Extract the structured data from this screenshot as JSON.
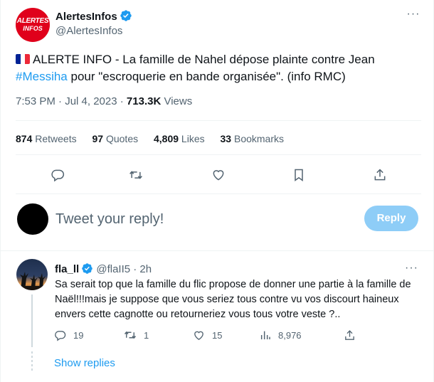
{
  "tweet": {
    "author": {
      "name": "AlertesInfos",
      "handle": "@AlertesInfos",
      "avatar_text_line1": "ALERTES",
      "avatar_text_line2": "INFOS",
      "verified_icon": "verified-badge-icon"
    },
    "more_icon": "more-horizontal-icon",
    "flag_icon": "france-flag-icon",
    "text_part1": "ALERTE INFO - La famille de Nahel dépose plainte contre Jean",
    "hashtag": "#Messiha",
    "text_part2": " pour \"escroquerie en bande organisée\". (info RMC)",
    "time": "7:53 PM · Jul 4, 2023 · ",
    "views_count": "713.3K",
    "views_label": " Views",
    "stats": {
      "retweets_count": "874",
      "retweets_label": " Retweets",
      "quotes_count": "97",
      "quotes_label": " Quotes",
      "likes_count": "4,809",
      "likes_label": " Likes",
      "bookmarks_count": "33",
      "bookmarks_label": " Bookmarks"
    },
    "actions": [
      "reply-icon",
      "retweet-icon",
      "like-icon",
      "bookmark-icon",
      "share-icon"
    ]
  },
  "composer": {
    "placeholder": "Tweet your reply!",
    "button_label": "Reply"
  },
  "reply": {
    "name": "fla_ll",
    "handle_time": " @flaII5 · 2h",
    "text": "Sa serait top que la famille du flic propose de donner une partie à la famille de Naël!!!mais je suppose que vous seriez tous contre vu vos discourt haineux envers cette cagnotte ou retourneriez vous tous votre veste ?..",
    "counts": {
      "replies": "19",
      "retweets": "1",
      "likes": "15",
      "views": "8,976"
    },
    "show_replies": "Show replies"
  },
  "colors": {
    "accent": "#1d9bf0",
    "muted": "#536471",
    "brand_red": "#e0001b",
    "reply_button_disabled": "#8ecdf7"
  }
}
